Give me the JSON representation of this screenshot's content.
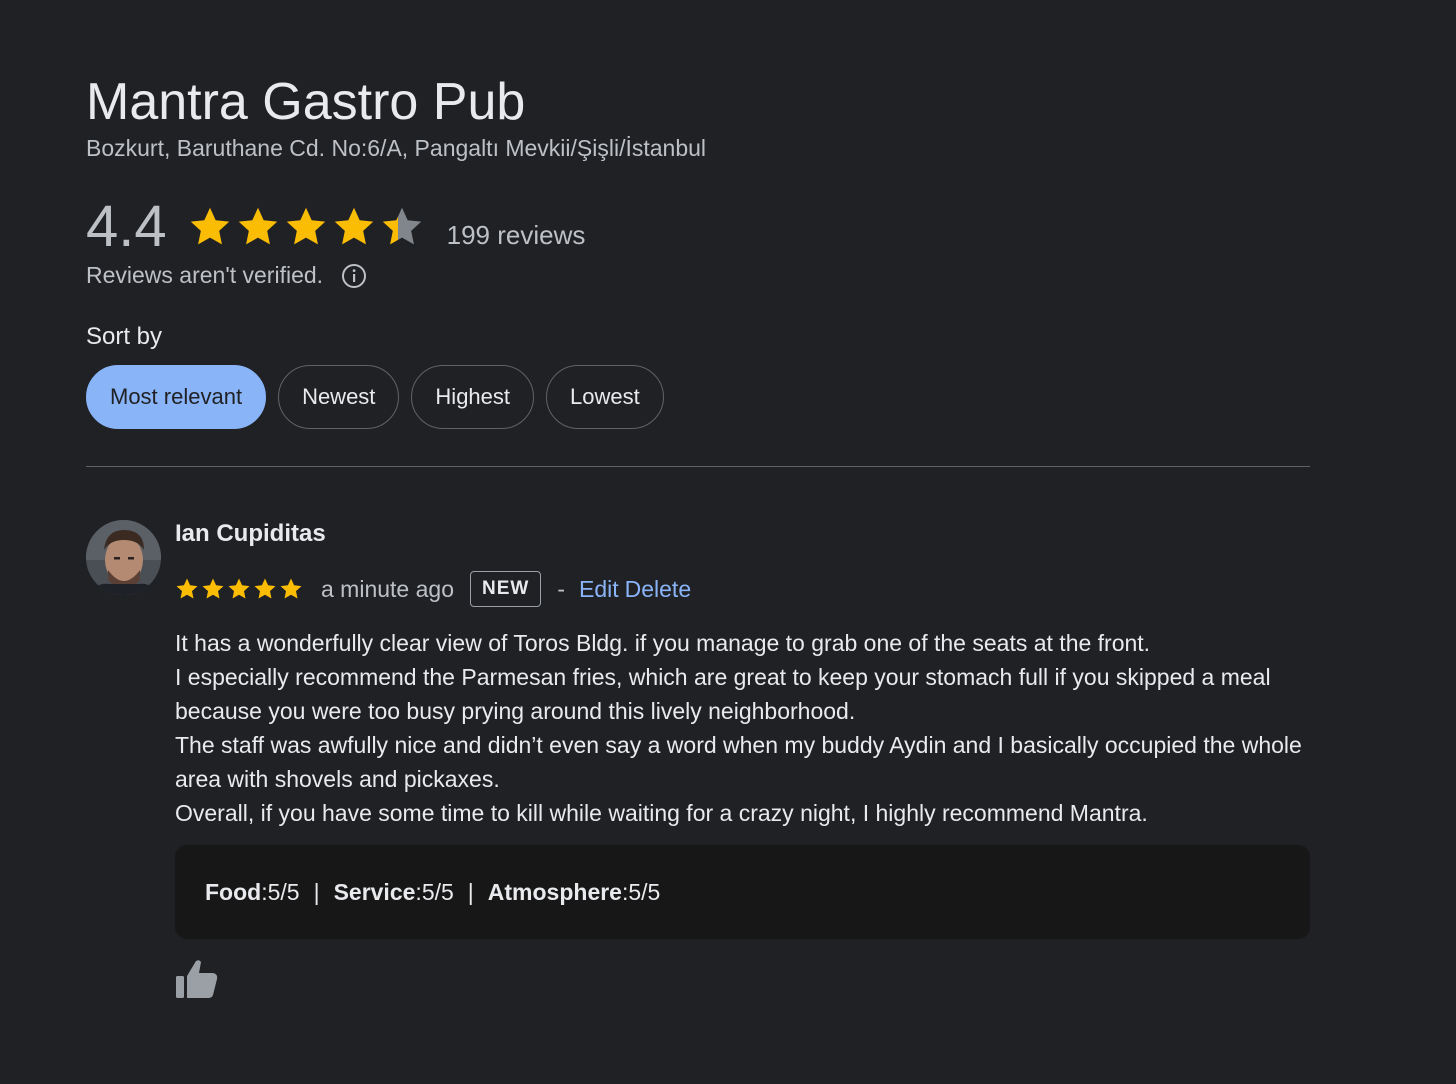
{
  "place": {
    "name": "Mantra Gastro Pub",
    "address": "Bozkurt, Baruthane Cd. No:6/A, Pangaltı Mevkii/Şişli/İstanbul"
  },
  "rating": {
    "value": "4.4",
    "stars": 4.4,
    "review_count": "199 reviews",
    "unverified_note": "Reviews aren't verified.",
    "info_icon": "info-circle-icon",
    "star_color": "#fbbc04",
    "star_empty_color": "#80868b"
  },
  "sort": {
    "label": "Sort by",
    "options": [
      {
        "label": "Most relevant",
        "active": true
      },
      {
        "label": "Newest",
        "active": false
      },
      {
        "label": "Highest",
        "active": false
      },
      {
        "label": "Lowest",
        "active": false
      }
    ],
    "active_color": "#8ab4f8"
  },
  "review": {
    "author": "Ian Cupiditas",
    "stars": 5,
    "time": "a minute ago",
    "badge": "NEW",
    "separator": "-",
    "edit_label": "Edit",
    "delete_label": "Delete",
    "paragraphs": [
      "It has a wonderfully clear view of Toros Bldg. if you manage to grab one of the seats at the front.",
      "I especially recommend the Parmesan fries, which are great to keep your stomach full if you skipped a meal because you were too busy prying around this lively neighborhood.",
      "The staff was awfully nice and didn’t even say a word when my buddy Aydin and I basically occupied the whole area with shovels and pickaxes.",
      "Overall, if you have some time to kill while waiting for a crazy night, I highly recommend Mantra."
    ],
    "sub_ratings": [
      {
        "label": "Food",
        "value": "5/5"
      },
      {
        "label": "Service",
        "value": "5/5"
      },
      {
        "label": "Atmosphere",
        "value": "5/5"
      }
    ],
    "like_icon": "thumbs-up-icon"
  }
}
